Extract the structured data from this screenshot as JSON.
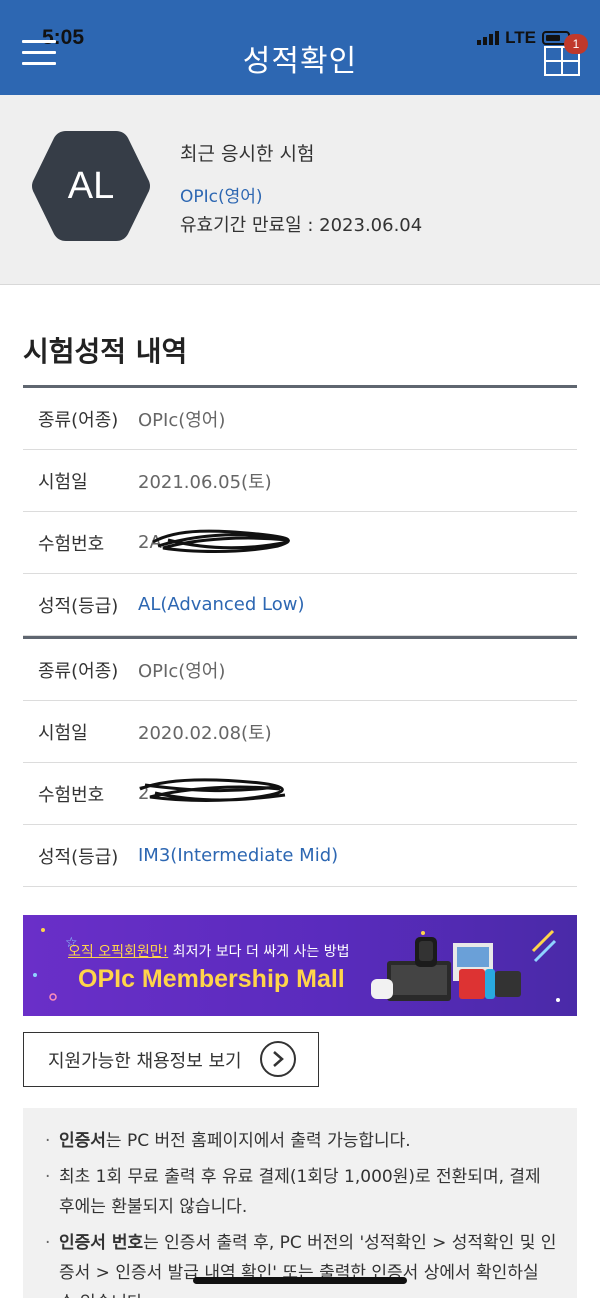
{
  "status_bar": {
    "time": "5:05",
    "network": "LTE",
    "badge": "1"
  },
  "header": {
    "title": "성적확인"
  },
  "profile": {
    "avatar_text": "AL",
    "recent_title": "최근 응시한 시험",
    "recent_exam": "OPIc(영어)",
    "expire_text": "유효기간 만료일 : 2023.06.04"
  },
  "history": {
    "title": "시험성적 내역",
    "records": [
      {
        "type_label": "종류(어종)",
        "type_value": "OPIc(영어)",
        "date_label": "시험일",
        "date_value": "2021.06.05(토)",
        "number_label": "수험번호",
        "number_value": "2A",
        "grade_label": "성적(등급)",
        "grade_value": "AL(Advanced Low)"
      },
      {
        "type_label": "종류(어종)",
        "type_value": "OPIc(영어)",
        "date_label": "시험일",
        "date_value": "2020.02.08(토)",
        "number_label": "수험번호",
        "number_value": "2",
        "grade_label": "성적(등급)",
        "grade_value": "IM3(Intermediate Mid)"
      }
    ]
  },
  "banner": {
    "sub_highlight": "오직 오픽회원만!",
    "sub_rest": " 최저가 보다 더 싸게 사는 방법",
    "main": "OPIc Membership Mall"
  },
  "job_button": {
    "label": "지원가능한 채용정보 보기"
  },
  "notice": {
    "items": [
      {
        "bold": "인증서",
        "text": "는 PC 버전 홈페이지에서 출력 가능합니다."
      },
      {
        "bold": "",
        "text": "최초 1회 무료 출력 후 유료 결제(1회당 1,000원)로 전환되며, 결제 후에는 환불되지 않습니다."
      },
      {
        "bold": "인증서 번호",
        "text": "는 인증서 출력 후, PC 버전의 '성적확인 > 성적확인 및 인증서 > 인증서 발급 내역 확인' 또는 출력한 인증서 상에서 확인하실 수 있습니다."
      }
    ]
  },
  "colors": {
    "header": "#2d67b2",
    "link": "#2d67b2",
    "avatar": "#363d47",
    "banner": "#5a2bbd",
    "banner_text": "#ffd54a"
  }
}
